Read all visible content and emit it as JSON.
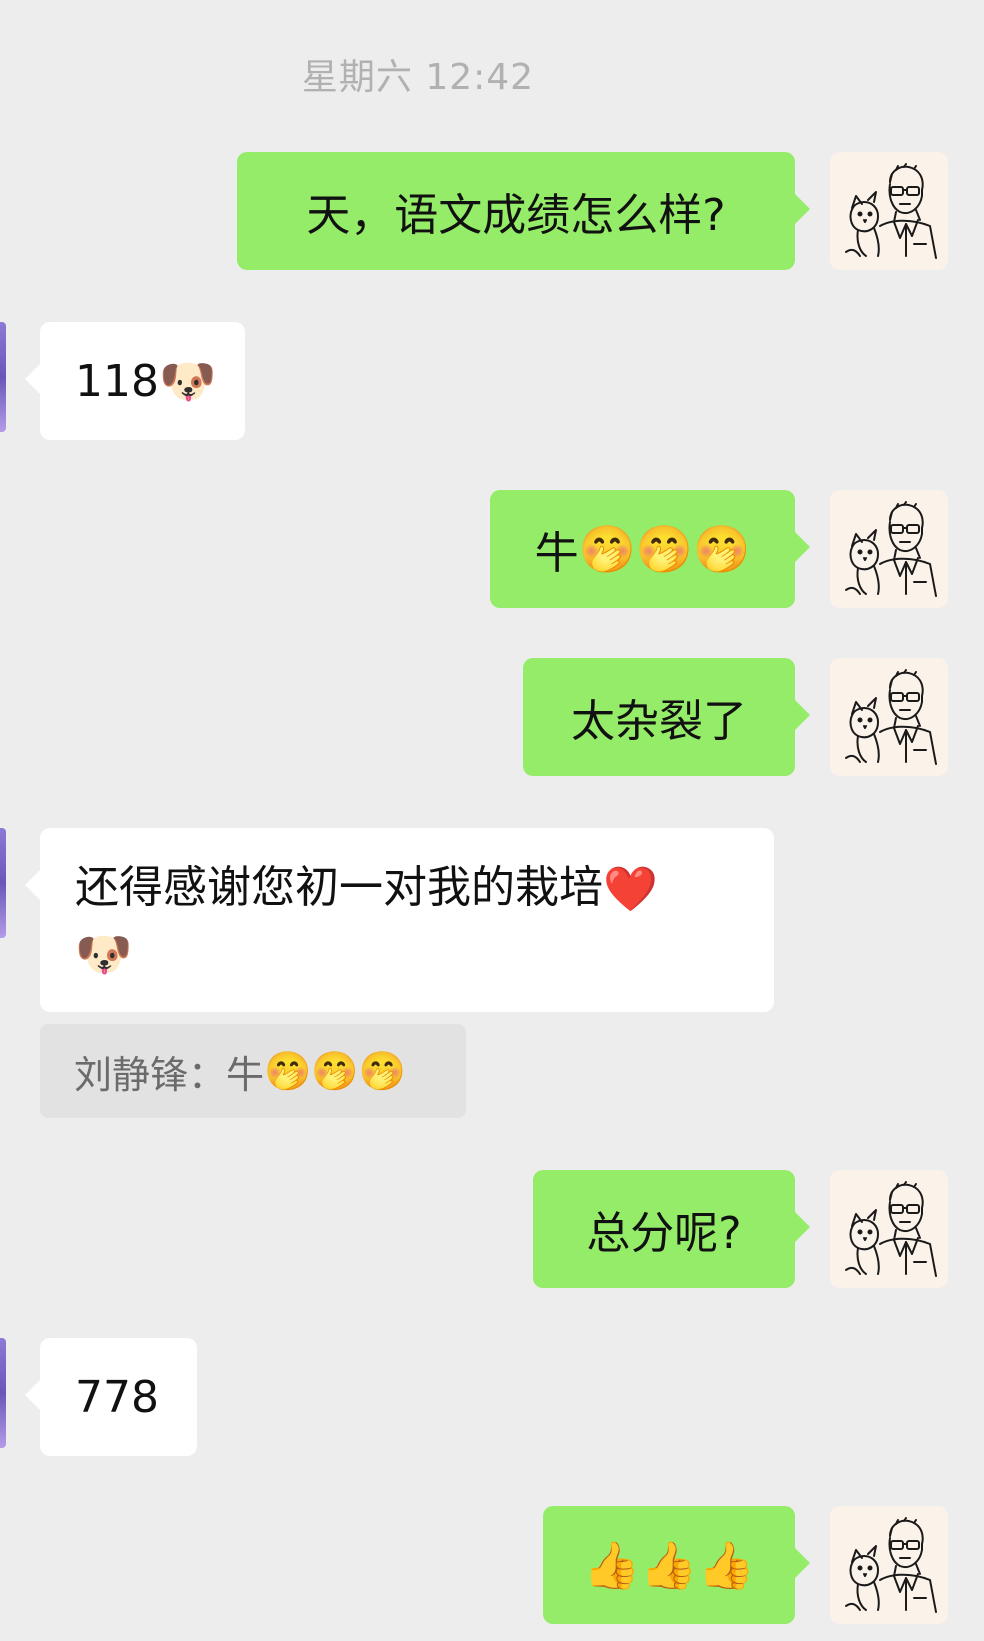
{
  "timestamp": "星期六 12:42",
  "messages": [
    {
      "text": "天，语文成绩怎么样?"
    },
    {
      "text": "118",
      "emoji": "🐶"
    },
    {
      "text": "牛",
      "emoji": "🤭🤭🤭"
    },
    {
      "text": "太杂裂了"
    },
    {
      "text": "还得感谢您初一对我的栽培",
      "emoji_heart": "❤️",
      "emoji_dog": "🐶"
    },
    {
      "quote_sender": "刘静锋：",
      "quote_text": "牛",
      "quote_emoji": "🤭🤭🤭"
    },
    {
      "text": "总分呢?"
    },
    {
      "text": "778"
    },
    {
      "emoji": "👍👍👍"
    }
  ],
  "colors": {
    "background": "#ededed",
    "outgoing_bubble": "#95ec69",
    "incoming_bubble": "#ffffff",
    "timestamp_text": "#b1b1b1",
    "quote_background": "#e2e2e2"
  },
  "icons": {
    "self_avatar": "sketch-man-with-glasses-and-cat-avatar",
    "contact_avatar": "purple-avatar-edge"
  }
}
